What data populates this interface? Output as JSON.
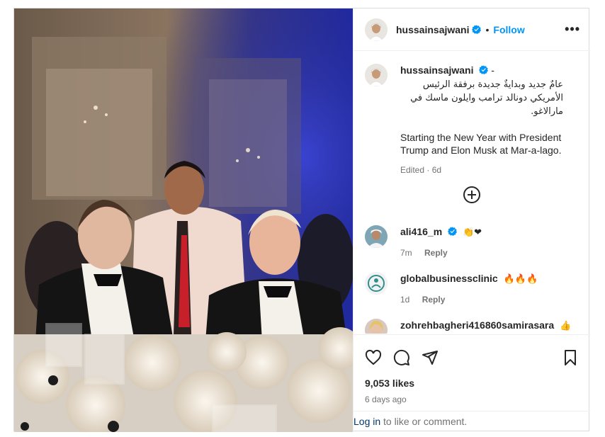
{
  "post": {
    "author": "hussainsajwani",
    "follow_label": "Follow",
    "separator": "•",
    "more_label": "•••",
    "caption_user": "hussainsajwani",
    "caption_dash": "-",
    "caption_arabic": "عامٌ جديد وبدايةٌ جديدة برفقة الرئيس الأمريكي دونالد ترامب وايلون ماسك في مارالاغو.",
    "caption_english": "Starting the New Year with President Trump and Elon Musk at Mar-a-lago.",
    "caption_meta": "Edited · 6d"
  },
  "comments": [
    {
      "user": "ali416_m",
      "emoji": "👏❤",
      "age": "7m",
      "reply": "Reply"
    },
    {
      "user": "globalbusinessclinic",
      "emoji": "🔥🔥🔥",
      "age": "1d",
      "reply": "Reply"
    },
    {
      "user": "zohrehbagheri416860samirasara",
      "emoji": "👍👍"
    }
  ],
  "footer": {
    "likes": "9,053 likes",
    "ago": "6 days ago",
    "login_link": "Log in",
    "login_rest": " to like or comment."
  },
  "colors": {
    "accent": "#0095f6",
    "link": "#00376b",
    "muted": "#737373"
  },
  "icons": [
    "heart-icon",
    "comment-icon",
    "share-icon",
    "bookmark-icon",
    "verified-icon",
    "plus-circle-icon",
    "more-icon"
  ]
}
